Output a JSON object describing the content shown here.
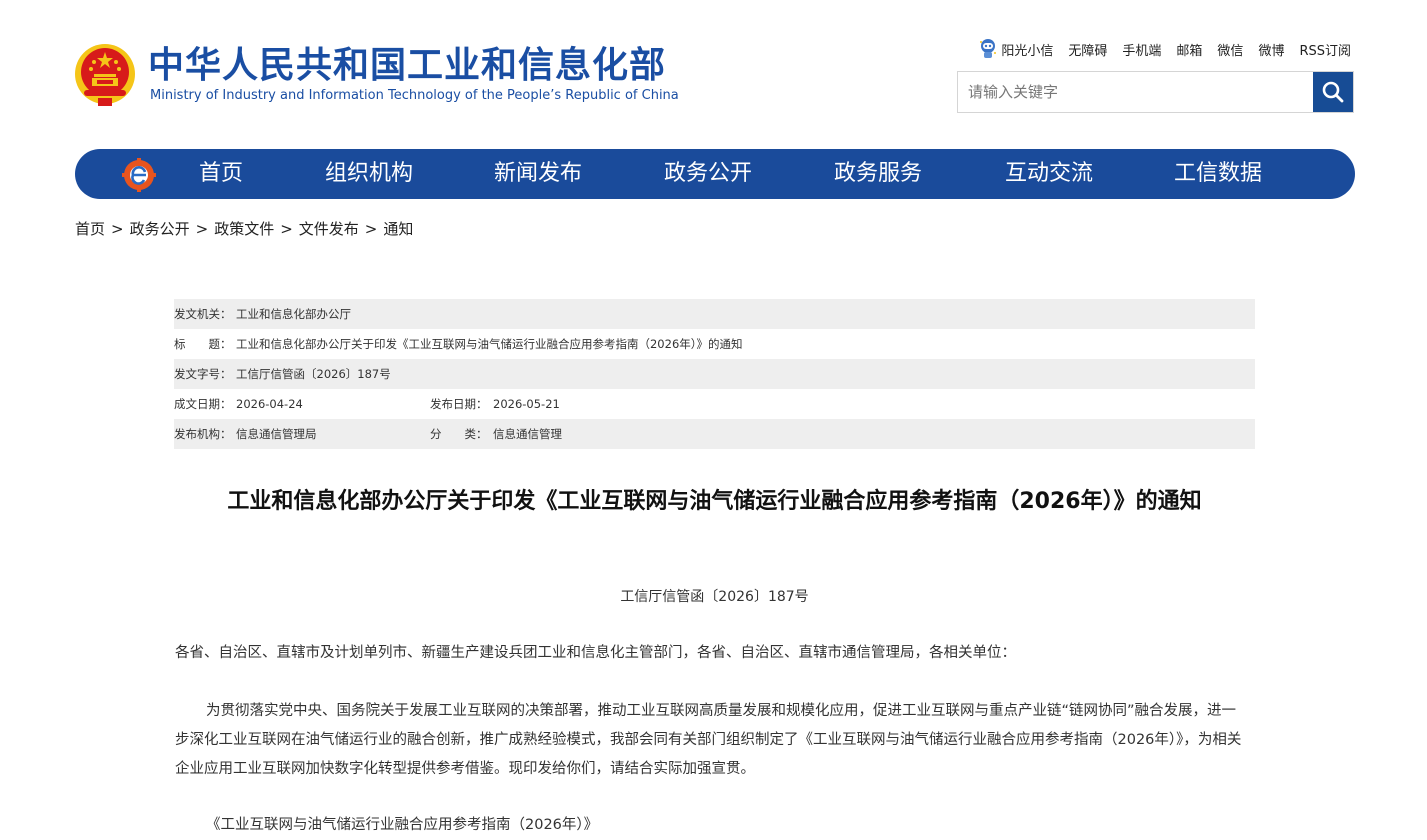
{
  "header": {
    "title_cn": "中华人民共和国工业和信息化部",
    "title_en": "Ministry of Industry and Information Technology of the People’s Republic of China",
    "toplinks": [
      "阳光小信",
      "无障碍",
      "手机端",
      "邮箱",
      "微信",
      "微博",
      "RSS订阅"
    ],
    "search_placeholder": "请输入关键字"
  },
  "nav": {
    "items": [
      "首页",
      "组织机构",
      "新闻发布",
      "政务公开",
      "政务服务",
      "互动交流",
      "工信数据"
    ]
  },
  "breadcrumb": {
    "items": [
      "首页",
      "政务公开",
      "政策文件",
      "文件发布",
      "通知"
    ],
    "separator": ">"
  },
  "meta": {
    "issuer_label": "发文机关：",
    "issuer": "工业和信息化部办公厅",
    "title_label": "标　　题：",
    "title": "工业和信息化部办公厅关于印发《工业互联网与油气储运行业融合应用参考指南（2026年）》的通知",
    "docno_label": "发文字号：",
    "docno": "工信厅信管函〔2026〕187号",
    "created_label": "成文日期：",
    "created": "2026-04-24",
    "published_label": "发布日期：",
    "published": "2026-05-21",
    "org_label": "发布机构：",
    "org": "信息通信管理局",
    "category_label": "分　　类：",
    "category": "信息通信管理"
  },
  "article": {
    "title": "工业和信息化部办公厅关于印发《工业互联网与油气储运行业融合应用参考指南（2026年）》的通知",
    "docno": "工信厅信管函〔2026〕187号",
    "addressee": "各省、自治区、直辖市及计划单列市、新疆生产建设兵团工业和信息化主管部门，各省、自治区、直辖市通信管理局，各相关单位：",
    "body": "为贯彻落实党中央、国务院关于发展工业互联网的决策部署，推动工业互联网高质量发展和规模化应用，促进工业互联网与重点产业链“链网协同”融合发展，进一步深化工业互联网在油气储运行业的融合创新，推广成熟经验模式，我部会同有关部门组织制定了《工业互联网与油气储运行业融合应用参考指南（2026年）》，为相关企业应用工业互联网加快数字化转型提供参考借鉴。现印发给你们，请结合实际加强宣贯。",
    "attachment": "《工业互联网与油气储运行业融合应用参考指南（2026年）》"
  },
  "colors": {
    "brand_blue": "#1a4b9b",
    "emblem_red": "#d71a1a",
    "emblem_gold": "#f5c518"
  }
}
